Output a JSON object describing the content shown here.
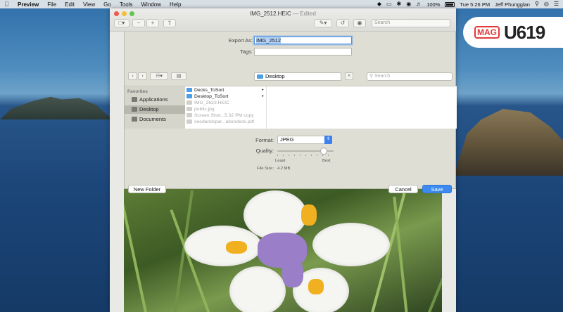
{
  "menubar": {
    "app_name": "Preview",
    "items": [
      "File",
      "Edit",
      "View",
      "Go",
      "Tools",
      "Window",
      "Help"
    ],
    "battery": "100%",
    "clock": "Tue 5:26 PM",
    "user": "Jeff Phungglan"
  },
  "window": {
    "filename": "IMG_2512.HEIC",
    "edited_suffix": "— Edited",
    "search_placeholder": "Search"
  },
  "export": {
    "export_as_label": "Export As:",
    "export_as_value": "IMG_2512",
    "tags_label": "Tags:",
    "location": "Desktop",
    "search_placeholder": "Search",
    "sidebar_header": "Favorites",
    "sidebar_items": [
      "Applications",
      "Desktop",
      "Documents"
    ],
    "files": [
      {
        "name": "Decks_ToSort",
        "folder": true,
        "dim": false
      },
      {
        "name": "Desktop_ToSort",
        "folder": true,
        "dim": false
      },
      {
        "name": "IMG_2623.HEIC",
        "folder": false,
        "dim": true
      },
      {
        "name": "public.jpg",
        "folder": false,
        "dim": true
      },
      {
        "name": "Screen Shot...5.32 PM copy",
        "folder": false,
        "dim": true
      },
      {
        "name": "seedandspar...ationdeck.pdf",
        "folder": false,
        "dim": true
      }
    ],
    "format_label": "Format:",
    "format_value": "JPEG",
    "quality_label": "Quality:",
    "quality_level": 0.82,
    "least_label": "Least",
    "best_label": "Best",
    "file_size_label": "File Size:",
    "file_size_value": "4.2 MB",
    "new_folder": "New Folder",
    "cancel": "Cancel",
    "save": "Save"
  },
  "watermark": {
    "mag": "MAG",
    "num": "U619"
  }
}
